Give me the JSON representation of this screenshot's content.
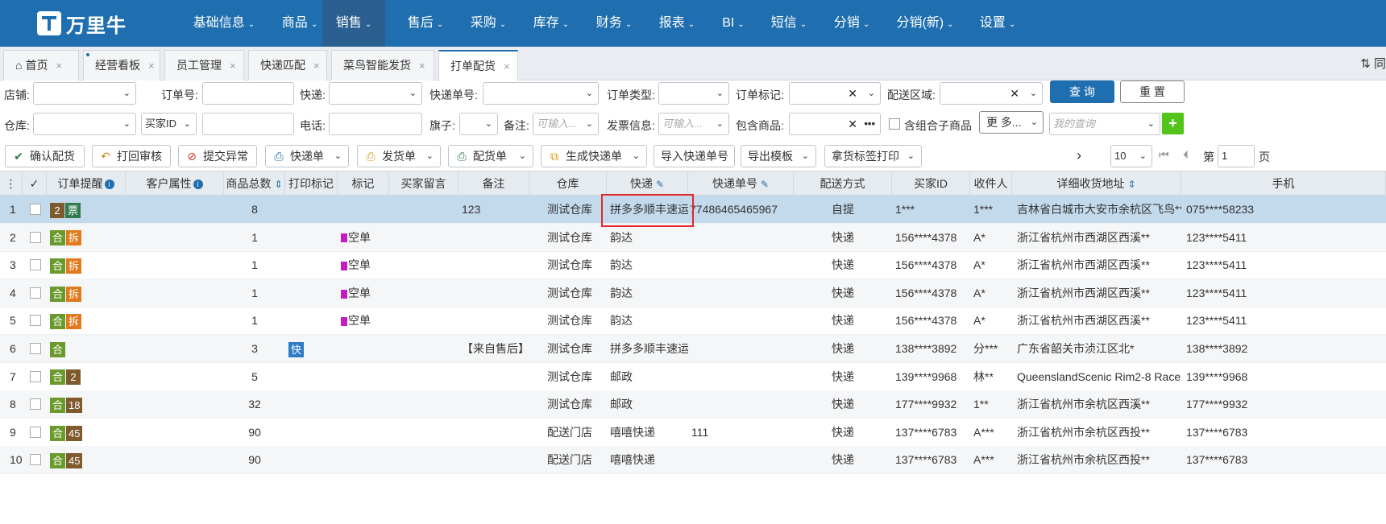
{
  "brand": {
    "logo_text": "万里牛",
    "accent": "#1f6fb0"
  },
  "nav": {
    "items": [
      {
        "label": "基础信息",
        "caret": "⌄"
      },
      {
        "label": "商品",
        "caret": "⌄"
      },
      {
        "label": "销售",
        "caret": "⌄",
        "active": true
      },
      {
        "label": "售后",
        "caret": "⌄"
      },
      {
        "label": "采购",
        "caret": "⌄"
      },
      {
        "label": "库存",
        "caret": "⌄"
      },
      {
        "label": "财务",
        "caret": "⌄"
      },
      {
        "label": "报表",
        "caret": "⌄"
      },
      {
        "label": "BI",
        "caret": "⌄"
      },
      {
        "label": "短信",
        "caret": "⌄"
      },
      {
        "label": "分销",
        "caret": "⌄"
      },
      {
        "label": "分销(新)",
        "caret": "⌄"
      },
      {
        "label": "设置",
        "caret": "⌄"
      }
    ]
  },
  "tabs": [
    {
      "label": "首页",
      "icon": "home-icon",
      "close": "×"
    },
    {
      "label": "经营看板",
      "close": "×"
    },
    {
      "label": "员工管理",
      "close": "×"
    },
    {
      "label": "快递匹配",
      "close": "×"
    },
    {
      "label": "菜鸟智能发货",
      "close": "×"
    },
    {
      "label": "打单配货",
      "close": "×",
      "active": true
    }
  ],
  "tab_right_text": "⇅ 同",
  "filters": {
    "row1": {
      "shop_label": "店铺:",
      "order_no_label": "订单号:",
      "express_label": "快递:",
      "tracking_label": "快递单号:",
      "order_type_label": "订单类型:",
      "order_mark_label": "订单标记:",
      "region_label": "配送区域:",
      "clear_glyph": "✕",
      "search_btn": "查 询",
      "reset_btn": "重 置"
    },
    "row2": {
      "warehouse_label": "仓库:",
      "buyer_id_select": "买家ID",
      "phone_label": "电话:",
      "flag_label": "旗子:",
      "remark_label": "备注:",
      "remark_placeholder": "可输入...",
      "invoice_label": "发票信息:",
      "invoice_placeholder": "可输入...",
      "contains_label": "包含商品:",
      "contains_more": "•••",
      "combo_label": "含组合子商品",
      "more_btn": "更 多...",
      "my_query_placeholder": "我的查询",
      "add_btn": "+"
    }
  },
  "toolbar": {
    "buttons": [
      {
        "label": "确认配货",
        "icon": "✔"
      },
      {
        "label": "打回审核",
        "icon": "↶"
      },
      {
        "label": "提交异常",
        "icon": "⊘"
      },
      {
        "label": "快递单",
        "icon": "⎙",
        "dropdown": true
      },
      {
        "label": "发货单",
        "icon": "⎙",
        "dropdown": true
      },
      {
        "label": "配货单",
        "icon": "⎙",
        "dropdown": true
      },
      {
        "label": "生成快递单",
        "icon": "⧉",
        "dropdown": true
      },
      {
        "label": "导入快递单号"
      },
      {
        "label": "导出模板",
        "dropdown": true
      },
      {
        "label": "拿货标签打印",
        "dropdown": true
      }
    ],
    "pager": {
      "next": "›",
      "page_size": "10",
      "first": "⏮",
      "prev": "⏴",
      "page_label": "第",
      "page_value": "1",
      "page_suffix": "页"
    }
  },
  "table": {
    "headers": [
      "⋮",
      "✓",
      "订单提醒",
      "客户属性",
      "商品总数",
      "打印标记",
      "标记",
      "买家留言",
      "备注",
      "仓库",
      "快递",
      "快递单号",
      "配送方式",
      "买家ID",
      "收件人",
      "详细收货地址",
      "手机"
    ],
    "rows": [
      {
        "n": "1",
        "tags": [
          {
            "t": "2",
            "c": "b-brown"
          },
          {
            "t": "票",
            "c": "b-dkgreen"
          }
        ],
        "qty": "8",
        "print": "",
        "mark": "",
        "msg": "",
        "remark": "123",
        "wh": "测试仓库",
        "exp": "拼多多顺丰速运",
        "track": "77486465465967",
        "ship": "自提",
        "buyer": "1***",
        "recv": "1***",
        "addr": "吉林省白城市大安市余杭区飞鸟***",
        "phone": "075****58233"
      },
      {
        "n": "2",
        "tags": [
          {
            "t": "合",
            "c": "b-green"
          },
          {
            "t": "拆",
            "c": "b-orange"
          }
        ],
        "qty": "1",
        "print": "",
        "mark": "空单",
        "msg": "",
        "remark": "",
        "wh": "测试仓库",
        "exp": "韵达",
        "track": "",
        "ship": "快递",
        "buyer": "156****4378",
        "recv": "A*",
        "addr": "浙江省杭州市西湖区西溪**",
        "phone": "123****5411"
      },
      {
        "n": "3",
        "tags": [
          {
            "t": "合",
            "c": "b-green"
          },
          {
            "t": "拆",
            "c": "b-orange"
          }
        ],
        "qty": "1",
        "print": "",
        "mark": "空单",
        "msg": "",
        "remark": "",
        "wh": "测试仓库",
        "exp": "韵达",
        "track": "",
        "ship": "快递",
        "buyer": "156****4378",
        "recv": "A*",
        "addr": "浙江省杭州市西湖区西溪**",
        "phone": "123****5411"
      },
      {
        "n": "4",
        "tags": [
          {
            "t": "合",
            "c": "b-green"
          },
          {
            "t": "拆",
            "c": "b-orange"
          }
        ],
        "qty": "1",
        "print": "",
        "mark": "空单",
        "msg": "",
        "remark": "",
        "wh": "测试仓库",
        "exp": "韵达",
        "track": "",
        "ship": "快递",
        "buyer": "156****4378",
        "recv": "A*",
        "addr": "浙江省杭州市西湖区西溪**",
        "phone": "123****5411"
      },
      {
        "n": "5",
        "tags": [
          {
            "t": "合",
            "c": "b-green"
          },
          {
            "t": "拆",
            "c": "b-orange"
          }
        ],
        "qty": "1",
        "print": "",
        "mark": "空单",
        "msg": "",
        "remark": "",
        "wh": "测试仓库",
        "exp": "韵达",
        "track": "",
        "ship": "快递",
        "buyer": "156****4378",
        "recv": "A*",
        "addr": "浙江省杭州市西湖区西溪**",
        "phone": "123****5411"
      },
      {
        "n": "6",
        "tags": [
          {
            "t": "合",
            "c": "b-green"
          }
        ],
        "qty": "3",
        "print": "快",
        "mark": "",
        "msg": "",
        "remark": "【来自售后】",
        "wh": "测试仓库",
        "exp": "拼多多顺丰速运",
        "track": "",
        "ship": "快递",
        "buyer": "138****3892",
        "recv": "分***",
        "addr": "广东省韶关市浈江区北*",
        "phone": "138****3892"
      },
      {
        "n": "7",
        "tags": [
          {
            "t": "合",
            "c": "b-green"
          },
          {
            "t": "2",
            "c": "b-brown"
          }
        ],
        "qty": "5",
        "print": "",
        "mark": "",
        "msg": "",
        "remark": "",
        "wh": "测试仓库",
        "exp": "邮政",
        "track": "",
        "ship": "快递",
        "buyer": "139****9968",
        "recv": "林**",
        "addr": "QueenslandScenic Rim2-8 Race",
        "phone": "139****9968"
      },
      {
        "n": "8",
        "tags": [
          {
            "t": "合",
            "c": "b-green"
          },
          {
            "t": "18",
            "c": "b-brown"
          }
        ],
        "qty": "32",
        "print": "",
        "mark": "",
        "msg": "",
        "remark": "",
        "wh": "测试仓库",
        "exp": "邮政",
        "track": "",
        "ship": "快递",
        "buyer": "177****9932",
        "recv": "1**",
        "addr": "浙江省杭州市余杭区西溪**",
        "phone": "177****9932"
      },
      {
        "n": "9",
        "tags": [
          {
            "t": "合",
            "c": "b-green"
          },
          {
            "t": "45",
            "c": "b-brown"
          }
        ],
        "qty": "90",
        "print": "",
        "mark": "",
        "msg": "",
        "remark": "",
        "wh": "配送门店",
        "exp": "嘻嘻快递",
        "track": "111",
        "ship": "快递",
        "buyer": "137****6783",
        "recv": "A***",
        "addr": "浙江省杭州市余杭区西投**",
        "phone": "137****6783"
      },
      {
        "n": "10",
        "tags": [
          {
            "t": "合",
            "c": "b-green"
          },
          {
            "t": "45",
            "c": "b-brown"
          }
        ],
        "qty": "90",
        "print": "",
        "mark": "",
        "msg": "",
        "remark": "",
        "wh": "配送门店",
        "exp": "嘻嘻快递",
        "track": "",
        "ship": "快递",
        "buyer": "137****6783",
        "recv": "A***",
        "addr": "浙江省杭州市余杭区西投**",
        "phone": "137****6783"
      }
    ]
  }
}
